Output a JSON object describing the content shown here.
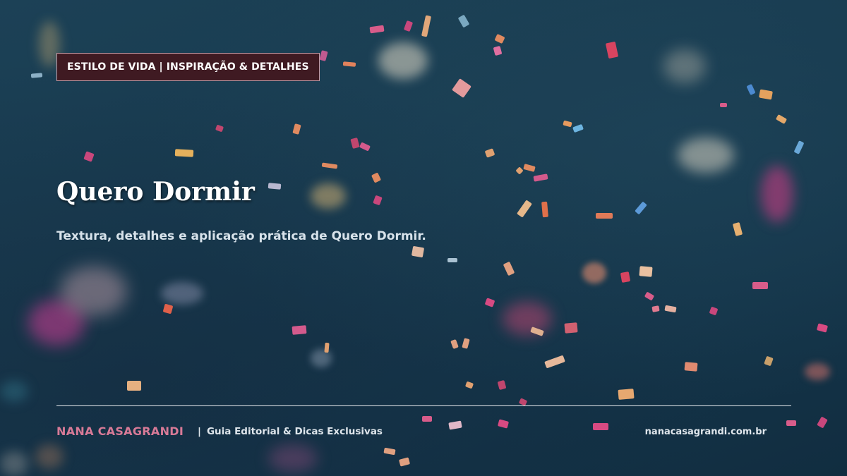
{
  "header": {
    "category_label": "ESTILO DE VIDA | INSPIRAÇÃO & DETALHES"
  },
  "hero": {
    "title": "Quero Dormir",
    "subtitle": "Textura, detalhes e aplicação prática de Quero Dormir."
  },
  "footer": {
    "brand": "NANA CASAGRANDI",
    "separator": "|",
    "tagline": "Guia Editorial & Dicas Exclusivas",
    "url": "nanacasagrandi.com.br"
  },
  "colors": {
    "background": "#17364a",
    "tag_background": "#3f1a22",
    "brand_pink": "#d87a97",
    "text_white": "#ffffff"
  }
}
